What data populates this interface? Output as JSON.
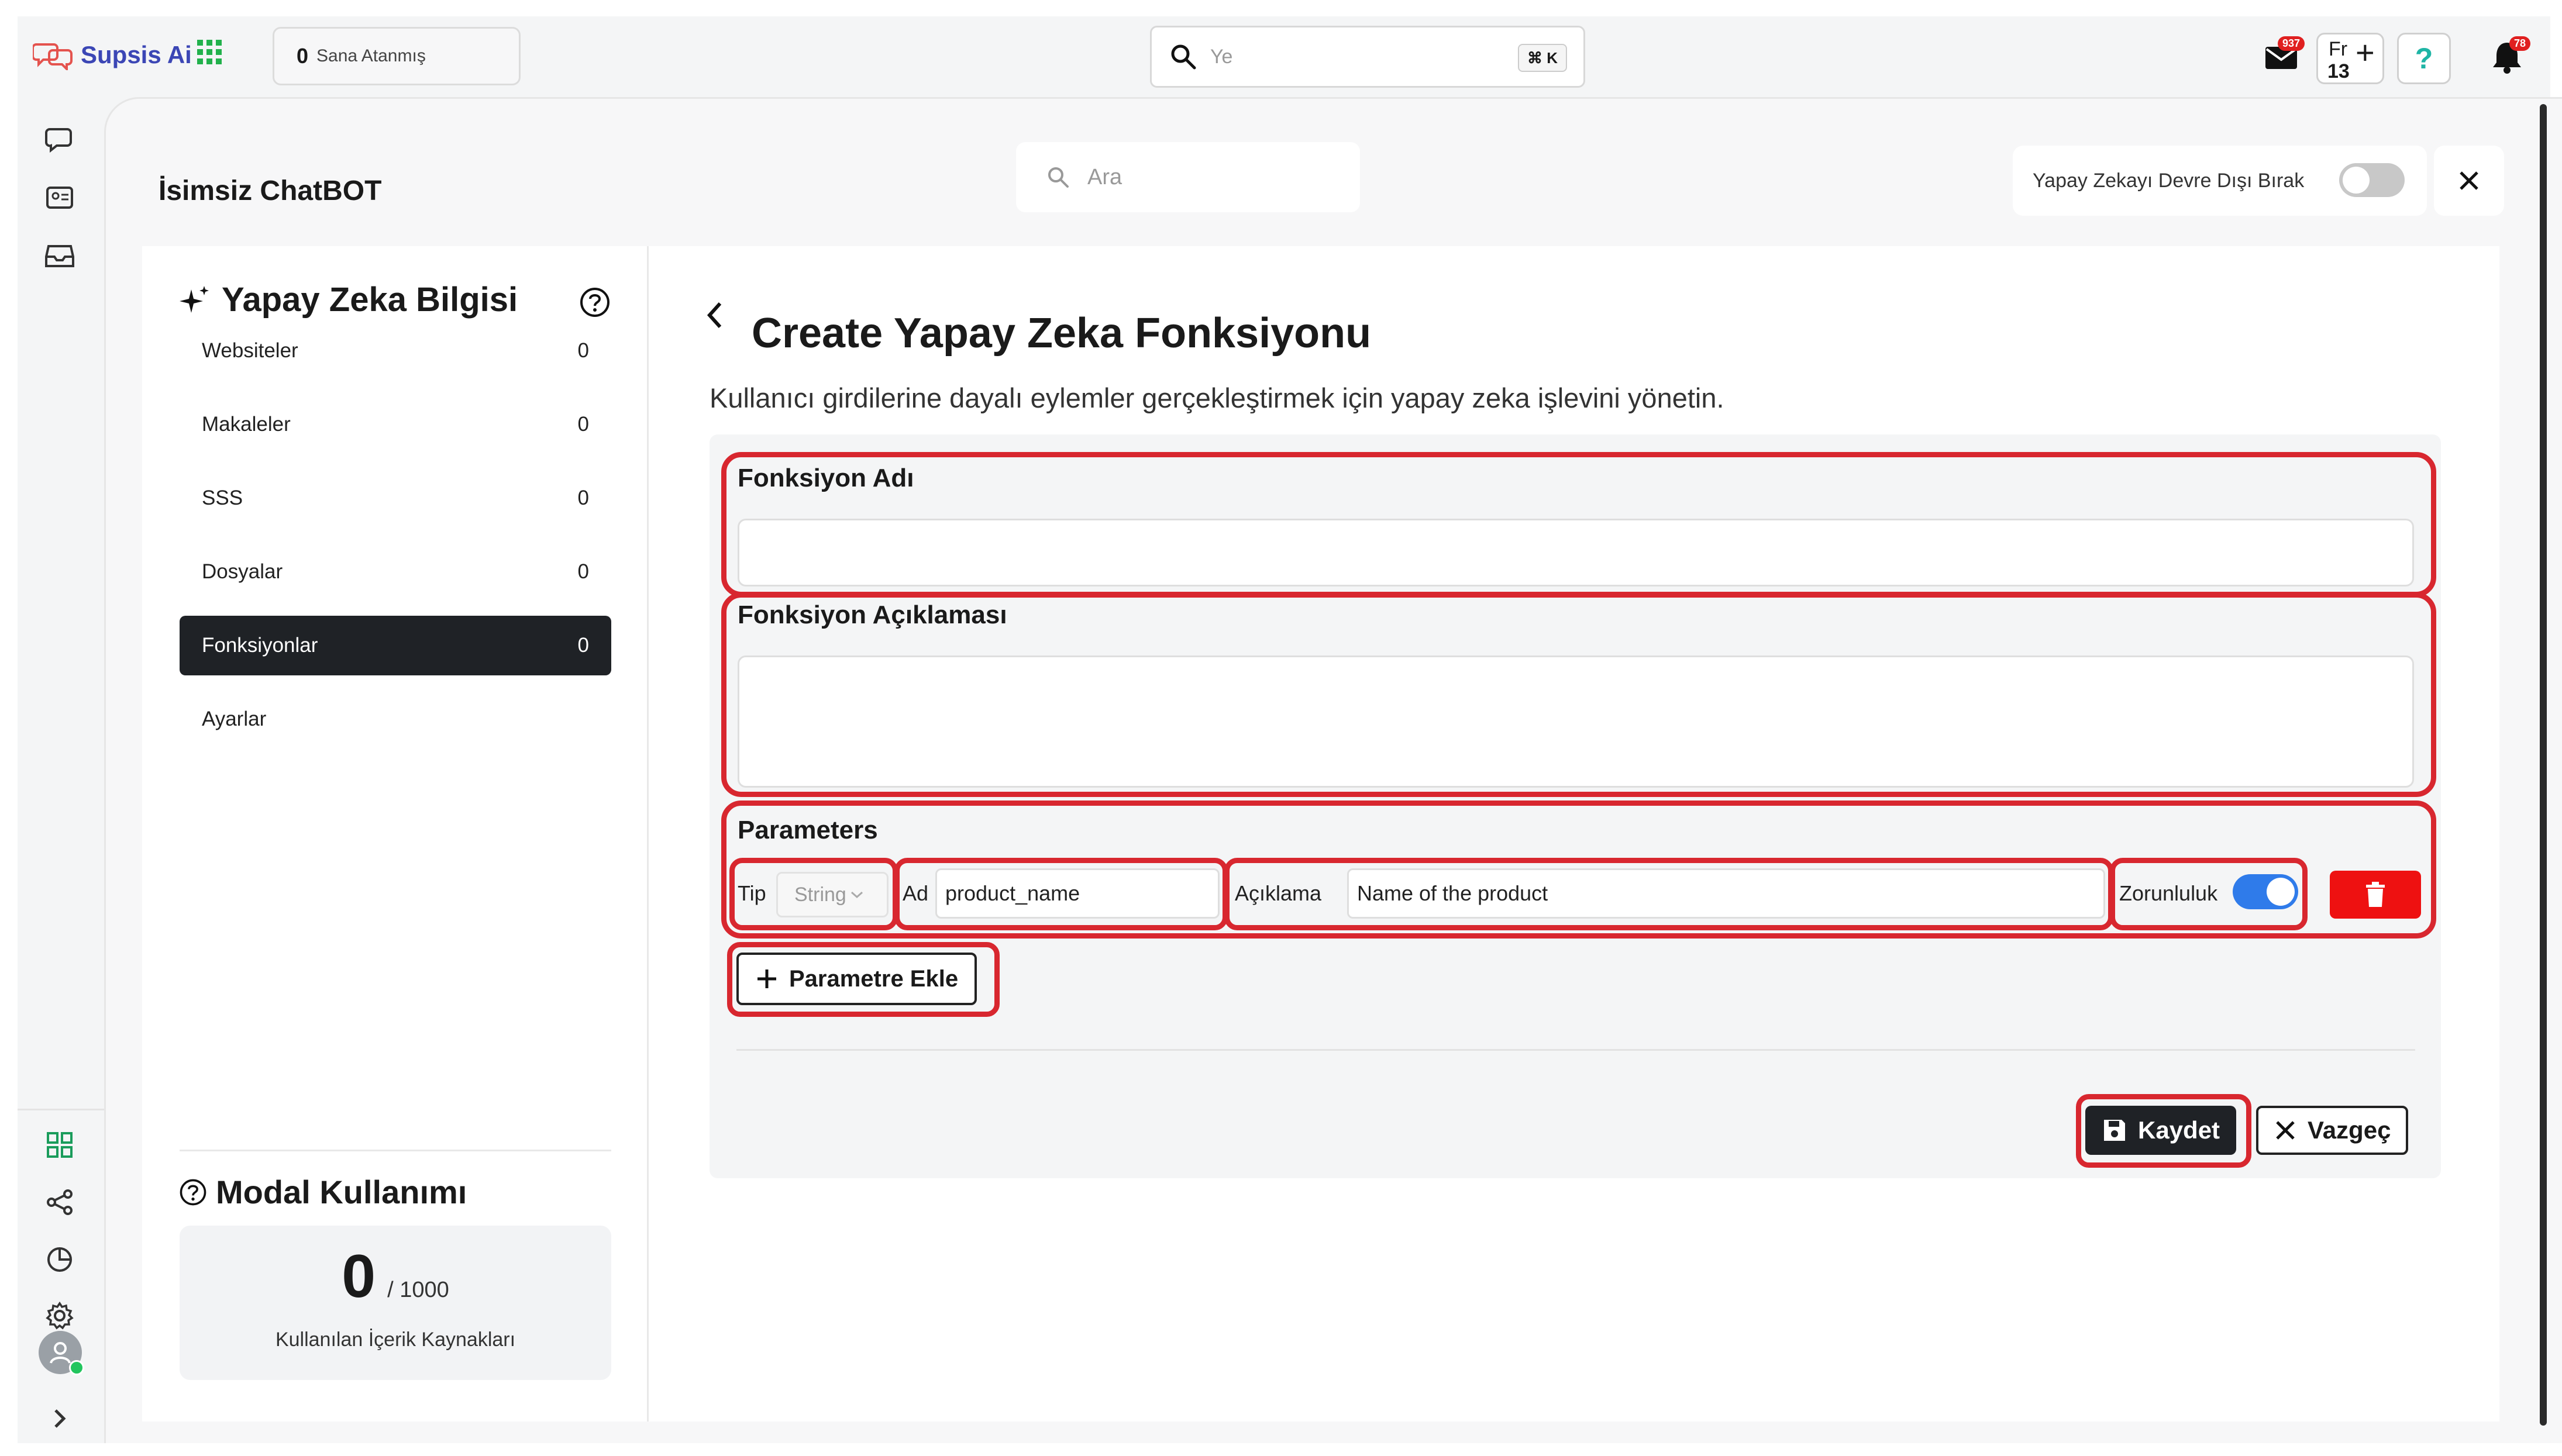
{
  "app": {
    "name": "Supsis Ai"
  },
  "topbar": {
    "assigned_count": "0",
    "assigned_label": "Sana Atanmış",
    "search_placeholder": "Ye",
    "search_shortcut": "⌘ K",
    "mail_badge": "937",
    "fr_label": "Fr",
    "fr_count": "13",
    "help_label": "?",
    "notif_badge": "78"
  },
  "header": {
    "bot_title": "İsimsiz ChatBOT",
    "search_placeholder": "Ara",
    "ai_toggle_label": "Yapay Zekayı Devre Dışı Bırak"
  },
  "sidebar": {
    "title": "Yapay Zeka Bilgisi",
    "items": [
      {
        "label": "Websiteler",
        "count": "0"
      },
      {
        "label": "Makaleler",
        "count": "0"
      },
      {
        "label": "SSS",
        "count": "0"
      },
      {
        "label": "Dosyalar",
        "count": "0"
      },
      {
        "label": "Fonksiyonlar",
        "count": "0",
        "active": true
      },
      {
        "label": "Ayarlar",
        "count": ""
      }
    ],
    "usage_title": "Modal Kullanımı",
    "usage_value": "0",
    "usage_limit": "/ 1000",
    "usage_caption": "Kullanılan İçerik Kaynakları"
  },
  "form": {
    "title": "Create Yapay Zeka Fonksiyonu",
    "subtitle": "Kullanıcı girdilerine dayalı eylemler gerçekleştirmek için yapay zeka işlevini yönetin.",
    "name_label": "Fonksiyon Adı",
    "name_value": "",
    "desc_label": "Fonksiyon Açıklaması",
    "desc_value": "",
    "params_label": "Parameters",
    "param": {
      "type_label": "Tip",
      "type_value": "String",
      "name_label": "Ad",
      "name_value": "product_name",
      "desc_label": "Açıklama",
      "desc_value": "Name of the product",
      "required_label": "Zorunluluk",
      "required": true
    },
    "add_param_label": "Parametre Ekle",
    "save_label": "Kaydet",
    "cancel_label": "Vazgeç"
  },
  "colors": {
    "accent_blue": "#2f7bea",
    "brand": "#3b46b5",
    "highlight_red": "#d8272f",
    "delete_red": "#ee1111",
    "dark": "#1f2226"
  }
}
